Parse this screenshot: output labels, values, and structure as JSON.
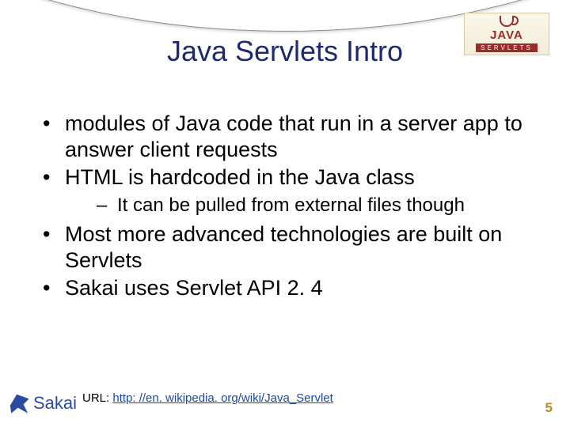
{
  "badge": {
    "brand": "JAVA",
    "sub": "SERVLETS"
  },
  "title": "Java Servlets Intro",
  "bullets": {
    "b1": "modules of Java code that run in a server app to answer client requests",
    "b2": "HTML is hardcoded in the Java class",
    "b2_sub1": "It can be pulled from external files though",
    "b3": "Most more advanced technologies are built on Servlets",
    "b4": "Sakai uses Servlet API 2. 4"
  },
  "url": {
    "label": "URL: ",
    "link_text": "http: //en. wikipedia. org/wiki/Java_Servlet"
  },
  "footer": {
    "logo_text": "Sakai",
    "page_number": "5"
  }
}
